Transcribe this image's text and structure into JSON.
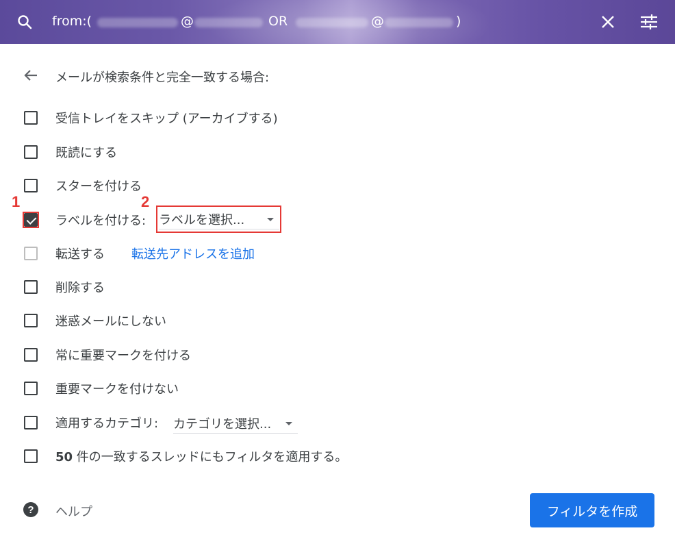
{
  "header": {
    "query_prefix": "from:(",
    "query_at1": "@",
    "query_or": "OR",
    "query_at2": "@",
    "query_suffix": ")"
  },
  "title": "メールが検索条件と完全一致する場合:",
  "options": [
    {
      "label": "受信トレイをスキップ (アーカイブする)",
      "checked": false
    },
    {
      "label": "既読にする",
      "checked": false
    },
    {
      "label": "スターを付ける",
      "checked": false
    },
    {
      "label": "ラベルを付ける:",
      "checked": true
    },
    {
      "label": "転送する",
      "checked": false,
      "disabled": true
    },
    {
      "label": "削除する",
      "checked": false
    },
    {
      "label": "迷惑メールにしない",
      "checked": false
    },
    {
      "label": "常に重要マークを付ける",
      "checked": false
    },
    {
      "label": "重要マークを付けない",
      "checked": false
    },
    {
      "label": "適用するカテゴリ:",
      "checked": false
    },
    {
      "label_count": "50",
      "label": " 件の一致するスレッドにもフィルタを適用する。",
      "checked": false
    }
  ],
  "label_select": {
    "selected": "ラベルを選択..."
  },
  "forward_link": "転送先アドレスを追加",
  "category_select": {
    "selected": "カテゴリを選択..."
  },
  "annotations": {
    "one": "1",
    "two": "2"
  },
  "help_label": "ヘルプ",
  "create_button": "フィルタを作成",
  "colors": {
    "accent": "#1a73e8",
    "annotation": "#e53935",
    "header": "#6a58a8"
  }
}
